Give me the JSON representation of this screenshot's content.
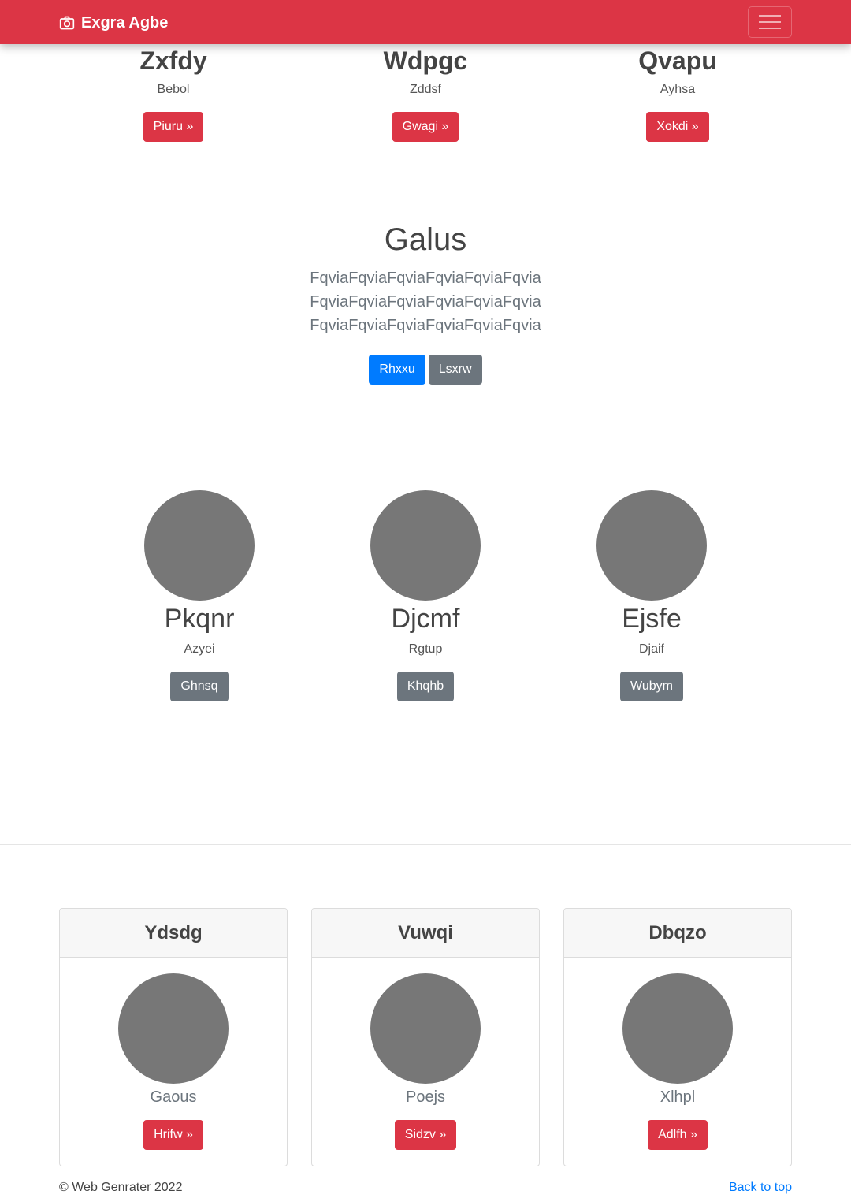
{
  "navbar": {
    "brand": "Exgra Agbe",
    "brand_icon": "camera-icon",
    "toggler_icon": "hamburger-menu-icon",
    "color": "#dc3545"
  },
  "features": [
    {
      "title": "Zxfdy",
      "subtitle": "Bebol",
      "button": "Piuru »"
    },
    {
      "title": "Wdpgc",
      "subtitle": "Zddsf",
      "button": "Gwagi »"
    },
    {
      "title": "Qvapu",
      "subtitle": "Ayhsa",
      "button": "Xokdi »"
    }
  ],
  "hero": {
    "title": "Galus",
    "text": "FqviaFqviaFqviaFqviaFqviaFqvia FqviaFqviaFqviaFqviaFqviaFqvia FqviaFqviaFqviaFqviaFqviaFqvia",
    "primary_button": "Rhxxu",
    "secondary_button": "Lsxrw"
  },
  "people": [
    {
      "name": "Pkqnr",
      "subtitle": "Azyei",
      "button": "Ghnsq"
    },
    {
      "name": "Djcmf",
      "subtitle": "Rgtup",
      "button": "Khqhb"
    },
    {
      "name": "Ejsfe",
      "subtitle": "Djaif",
      "button": "Wubym"
    }
  ],
  "cards": [
    {
      "header": "Ydsdg",
      "label": "Gaous",
      "button": "Hrifw »"
    },
    {
      "header": "Vuwqi",
      "label": "Poejs",
      "button": "Sidzv »"
    },
    {
      "header": "Dbqzo",
      "label": "Xlhpl",
      "button": "Adlfh »"
    }
  ],
  "footer": {
    "copyright": "© Web Genrater 2022",
    "back_to_top": "Back to top"
  }
}
